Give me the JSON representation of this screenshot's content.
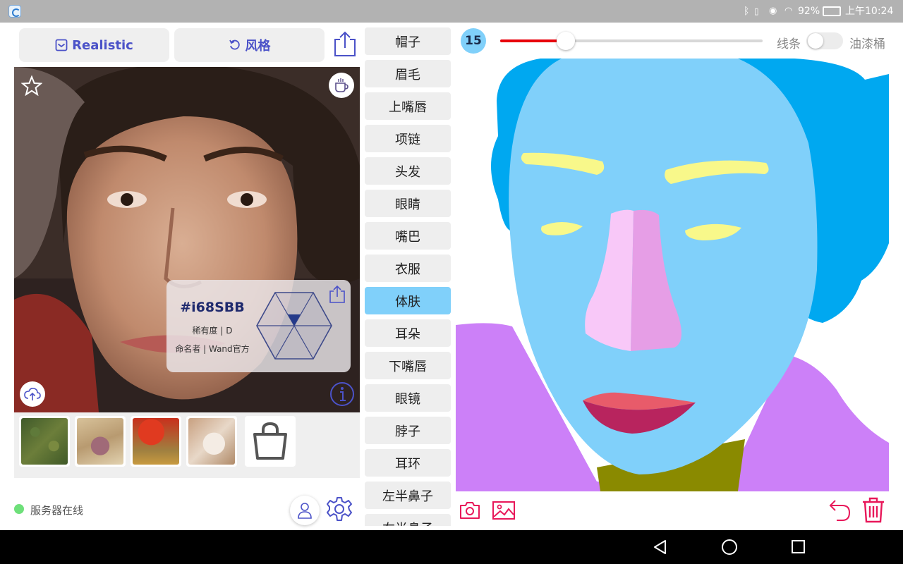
{
  "status_bar": {
    "battery": "92%",
    "time": "上午10:24"
  },
  "toolbar": {
    "realistic_label": "Realistic",
    "style_label": "风格"
  },
  "info_card": {
    "code": "#i68SBB",
    "rarity": "稀有度 | D",
    "namer": "命名者 | Wand官方"
  },
  "server": {
    "status_text": "服务器在线",
    "status_color": "#6ee07a"
  },
  "parts": [
    {
      "label": "帽子"
    },
    {
      "label": "眉毛"
    },
    {
      "label": "上嘴唇"
    },
    {
      "label": "项链"
    },
    {
      "label": "头发"
    },
    {
      "label": "眼睛"
    },
    {
      "label": "嘴巴"
    },
    {
      "label": "衣服"
    },
    {
      "label": "体肤"
    },
    {
      "label": "耳朵"
    },
    {
      "label": "下嘴唇"
    },
    {
      "label": "眼镜"
    },
    {
      "label": "脖子"
    },
    {
      "label": "耳环"
    },
    {
      "label": "左半鼻子"
    },
    {
      "label": "右半鼻子"
    }
  ],
  "active_part": "体肤",
  "brush": {
    "size": "15",
    "slider_fraction": 0.25,
    "mode_left": "线条",
    "mode_right": "油漆桶",
    "toggle_on": false
  },
  "colors": {
    "accent": "#4b52c8",
    "pink_accent": "#e8185a",
    "slider_red": "#e8000b",
    "badge_blue": "#80d0fa",
    "hair": "#00a8f0",
    "skin": "#80d0fa",
    "brow_eye": "#f8f88a",
    "nose_left": "#f8c8f8",
    "nose_right": "#e69ee6",
    "upper_lip": "#e85b6a",
    "lower_lip": "#b8245e",
    "clothes": "#cc80f8",
    "neck": "#8a8a00"
  }
}
